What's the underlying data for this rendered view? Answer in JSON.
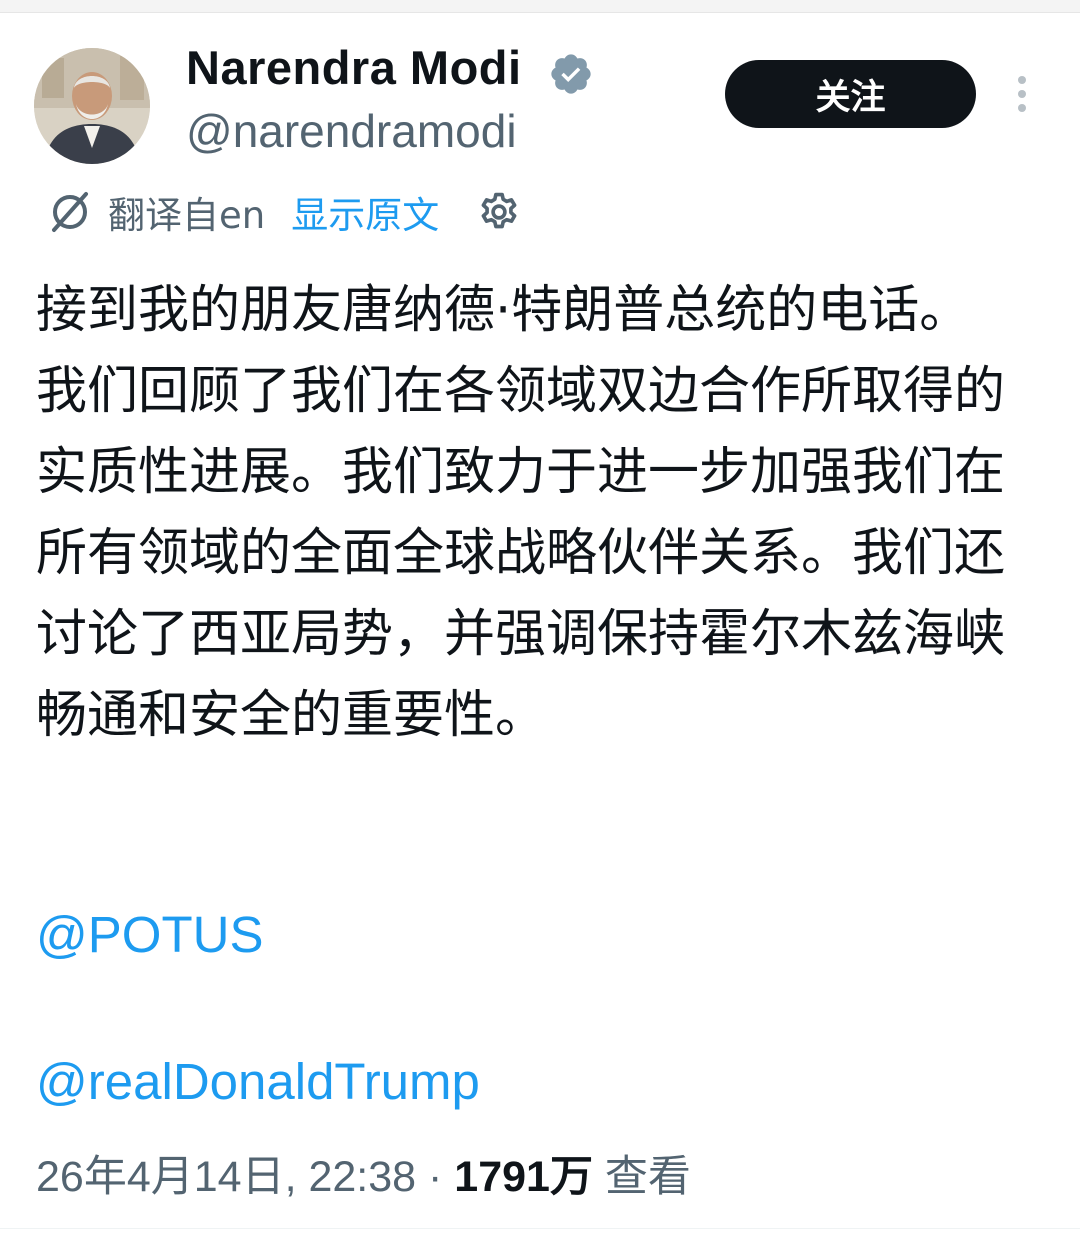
{
  "author": {
    "name": "Narendra Modi",
    "handle": "@narendramodi",
    "verified_icon": "verified-badge-icon",
    "avatar": "avatar"
  },
  "follow_button": {
    "label": "关注"
  },
  "translation": {
    "from_label": "翻译自en",
    "show_original": "显示原文"
  },
  "tweet": {
    "text": "接到我的朋友唐纳德·特朗普总统的电话。我们回顾了我们在各领域双边合作所取得的实质性进展。我们致力于进一步加强我们在所有领域的全面全球战略伙伴关系。我们还讨论了西亚局势，并强调保持霍尔木兹海峡畅通和安全的重要性。",
    "mentions": [
      "@POTUS",
      "@realDonaldTrump"
    ]
  },
  "meta": {
    "timestamp": "26年4月14日, 22:38",
    "separator": " · ",
    "views": "1791万",
    "views_label": " 查看"
  },
  "colors": {
    "text": "#0f1419",
    "secondary": "#536471",
    "link": "#1d9bf0",
    "button_bg": "#0f1419"
  }
}
